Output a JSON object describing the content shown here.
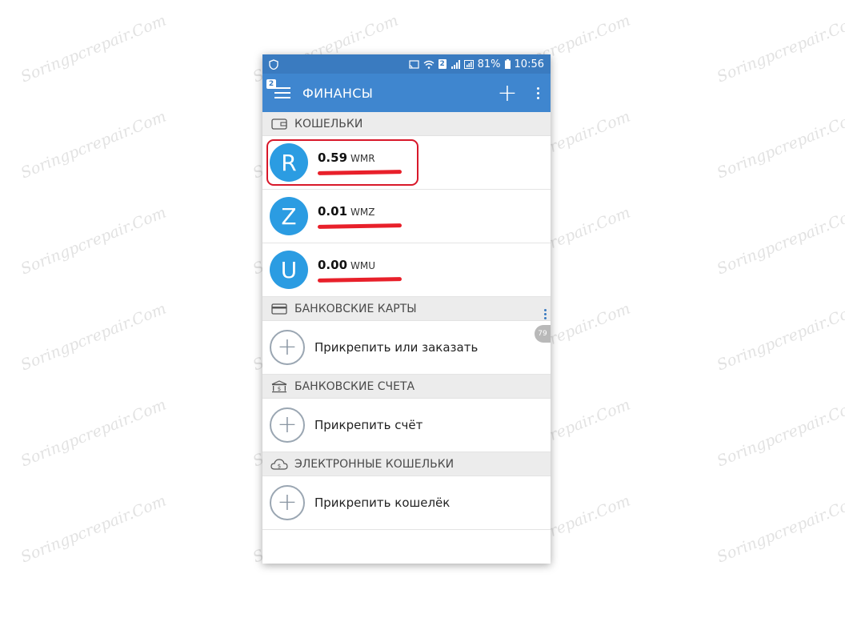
{
  "watermark": "Soringpcrepair.Com",
  "statusbar": {
    "battery": "81%",
    "time": "10:56",
    "sim_slot": "2"
  },
  "appbar": {
    "title": "ФИНАНСЫ",
    "nav_badge": "2",
    "add_symbol": "+"
  },
  "sections": {
    "wallets": {
      "title": "КОШЕЛЬКИ"
    },
    "cards": {
      "title": "БАНКОВСКИЕ КАРТЫ",
      "action": "Прикрепить или заказать"
    },
    "accounts": {
      "title": "БАНКОВСКИЕ СЧЕТА",
      "action": "Прикрепить счёт"
    },
    "ewallets": {
      "title": "ЭЛЕКТРОННЫЕ КОШЕЛЬКИ",
      "action": "Прикрепить кошелёк"
    }
  },
  "wallets": [
    {
      "letter": "R",
      "amount": "0.59",
      "currency": "WMR"
    },
    {
      "letter": "Z",
      "amount": "0.01",
      "currency": "WMZ"
    },
    {
      "letter": "U",
      "amount": "0.00",
      "currency": "WMU"
    }
  ],
  "plus_symbol": "+",
  "scroll_counter": "79",
  "colors": {
    "statusbar": "#3a7bc0",
    "appbar": "#3f86cf",
    "avatar": "#2b9ce2",
    "section_bg": "#ececec",
    "highlight": "#d8182a"
  },
  "icons": {
    "wallet": "wallet-icon",
    "card": "credit-card-icon",
    "bank": "bank-icon",
    "ewallet": "cloud-money-icon"
  }
}
